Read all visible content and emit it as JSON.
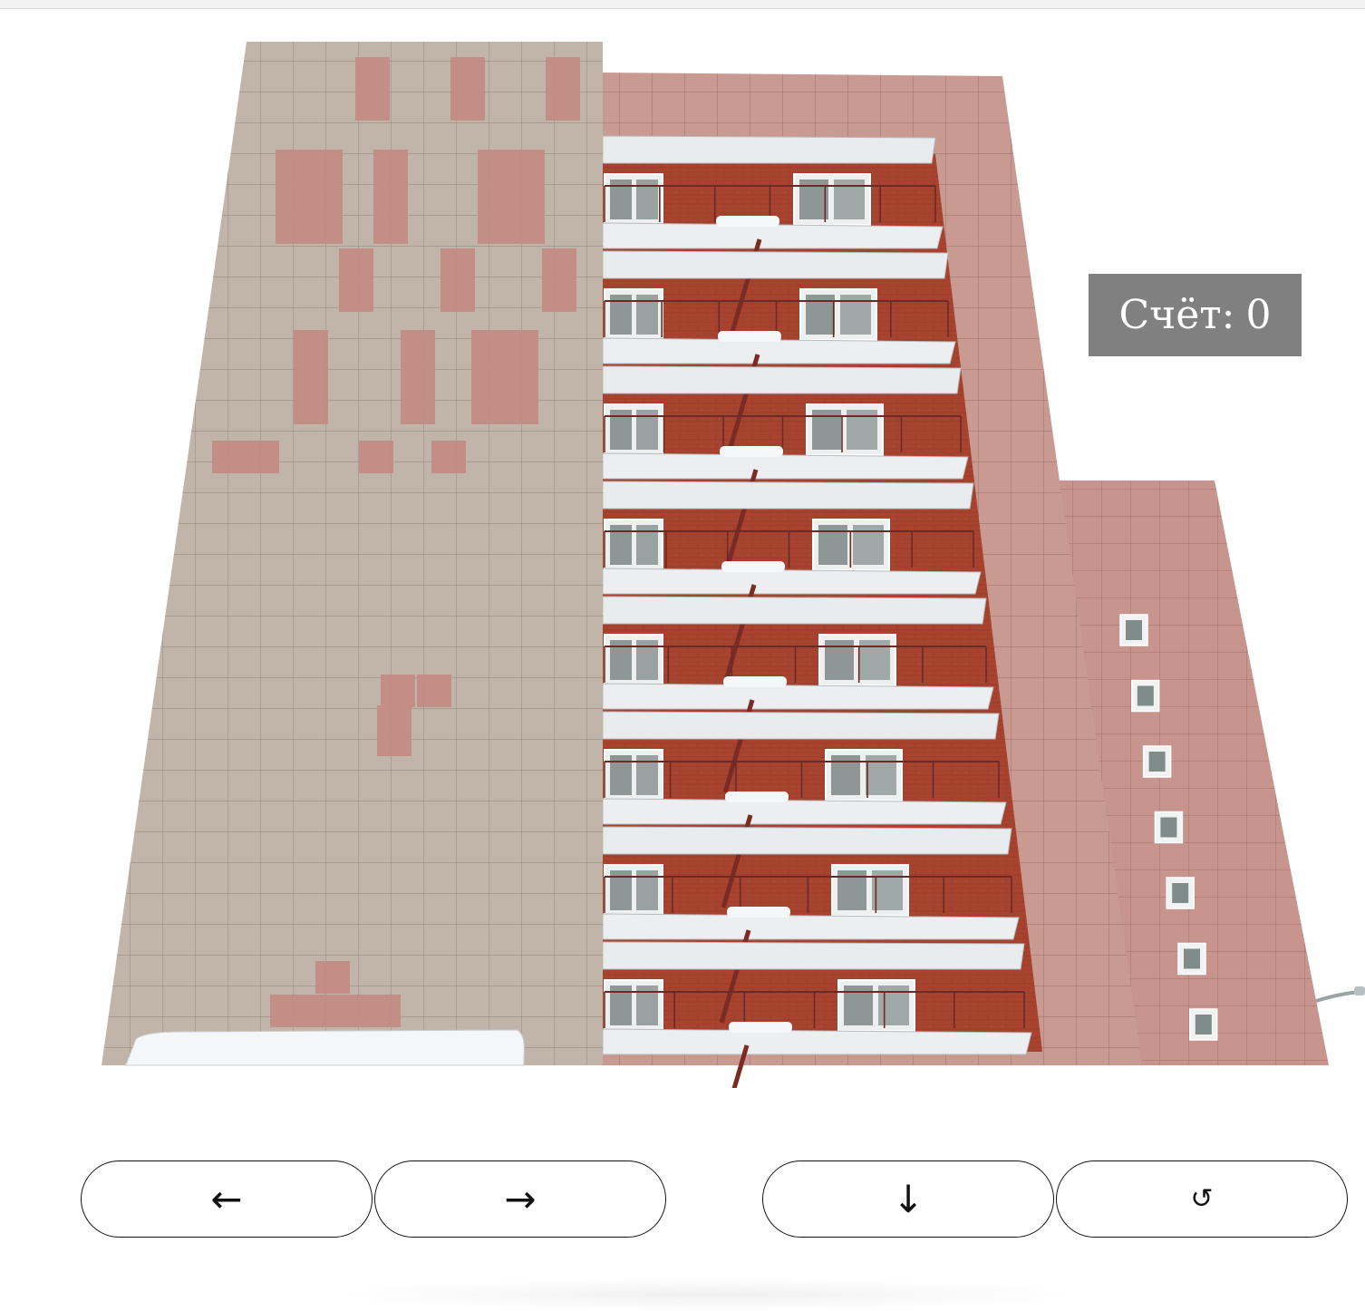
{
  "score": {
    "label": "Счёт:",
    "value": "0"
  },
  "controls": {
    "left_label": "←",
    "right_label": "→",
    "down_label": "↓",
    "rotate_label": "↺"
  },
  "icons": [
    "arrow-left-icon",
    "arrow-right-icon",
    "arrow-down-icon",
    "rotate-icon"
  ],
  "colors": {
    "light_tile": "#bdb1a6",
    "pink_tile": "#c98e86",
    "brick": "#a8432f",
    "side_wall": "#c6958c",
    "score_bg": "#808080"
  }
}
